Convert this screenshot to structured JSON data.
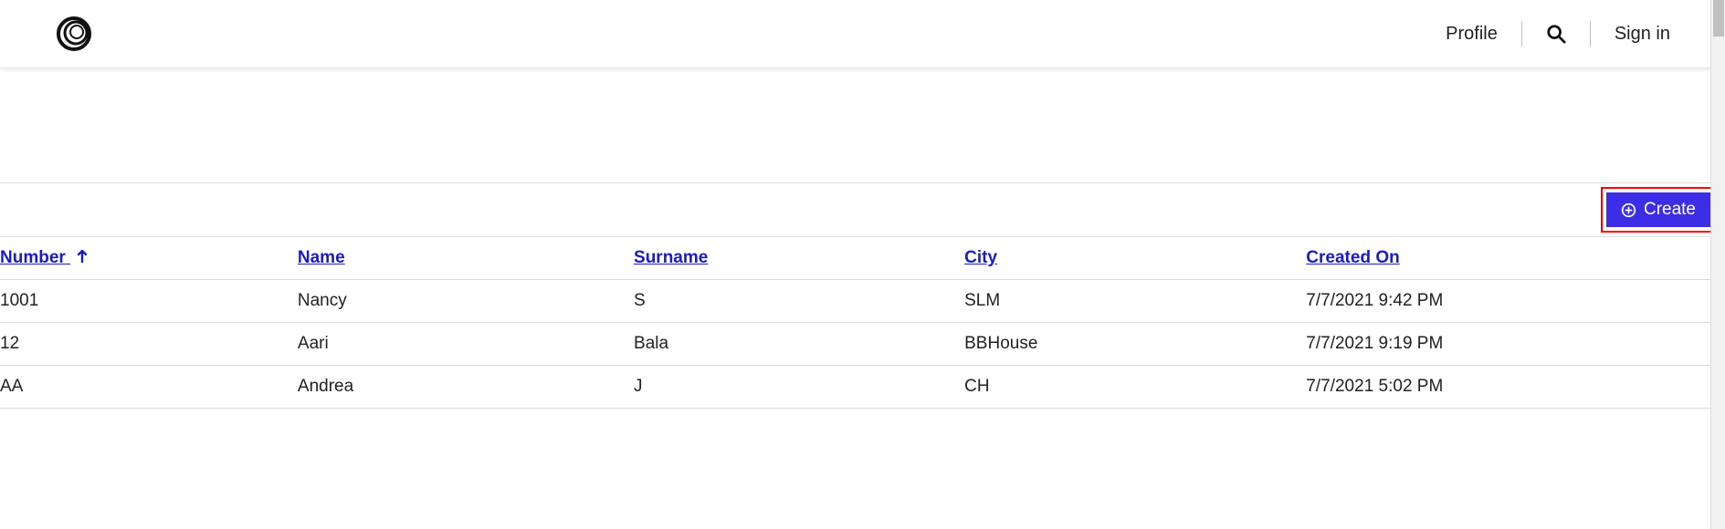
{
  "header": {
    "profile_label": "Profile",
    "signin_label": "Sign in"
  },
  "toolbar": {
    "create_label": "Create"
  },
  "table": {
    "columns": {
      "number": "Number",
      "name": "Name",
      "surname": "Surname",
      "city": "City",
      "created_on": "Created On"
    },
    "sort": {
      "column": "number",
      "direction": "asc"
    },
    "rows": [
      {
        "number": "1001",
        "name": "Nancy",
        "surname": "S",
        "city": "SLM",
        "created_on": "7/7/2021 9:42 PM"
      },
      {
        "number": "12",
        "name": "Aari",
        "surname": "Bala",
        "city": "BBHouse",
        "created_on": "7/7/2021 9:19 PM"
      },
      {
        "number": "AA",
        "name": "Andrea",
        "surname": "J",
        "city": "CH",
        "created_on": "7/7/2021 5:02 PM"
      }
    ]
  }
}
